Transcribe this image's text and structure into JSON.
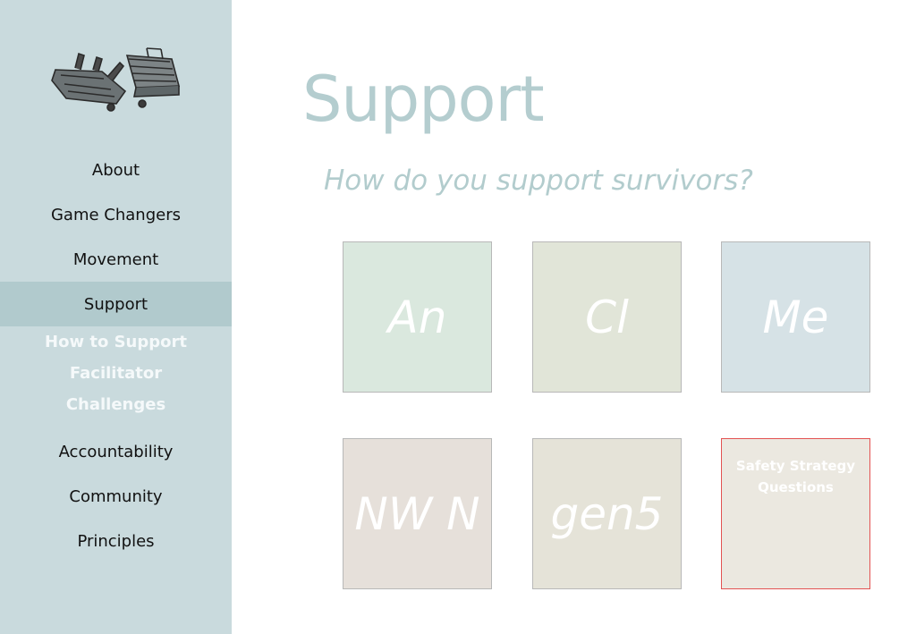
{
  "sidebar": {
    "logo_icon": "toolbox-icon",
    "items": [
      {
        "label": "About"
      },
      {
        "label": "Game Changers"
      },
      {
        "label": "Movement"
      },
      {
        "label": "Support",
        "active": true
      },
      {
        "label": "Accountability"
      },
      {
        "label": "Community"
      },
      {
        "label": "Principles"
      }
    ],
    "subitems": [
      {
        "label": "How to Support"
      },
      {
        "label": "Facilitator"
      },
      {
        "label": "Challenges"
      }
    ]
  },
  "main": {
    "title": "Support",
    "subtitle": "How do you support survivors?",
    "tiles": [
      {
        "label": "An",
        "color": "#dae8de"
      },
      {
        "label": "Cl",
        "color": "#e1e5d8"
      },
      {
        "label": "Me",
        "color": "#d6e2e6"
      },
      {
        "label": "NW N",
        "color": "#e6e0da"
      },
      {
        "label": "gen5",
        "color": "#e5e3d8"
      },
      {
        "label_line1": "Safety Strategy",
        "label_line2": "Questions",
        "color": "#ebe8e0",
        "border": "#e35252"
      }
    ]
  },
  "colors": {
    "sidebar_bg": "#c9dadd",
    "active_bg": "#b1cacd",
    "title_color": "#b4cdcf"
  }
}
